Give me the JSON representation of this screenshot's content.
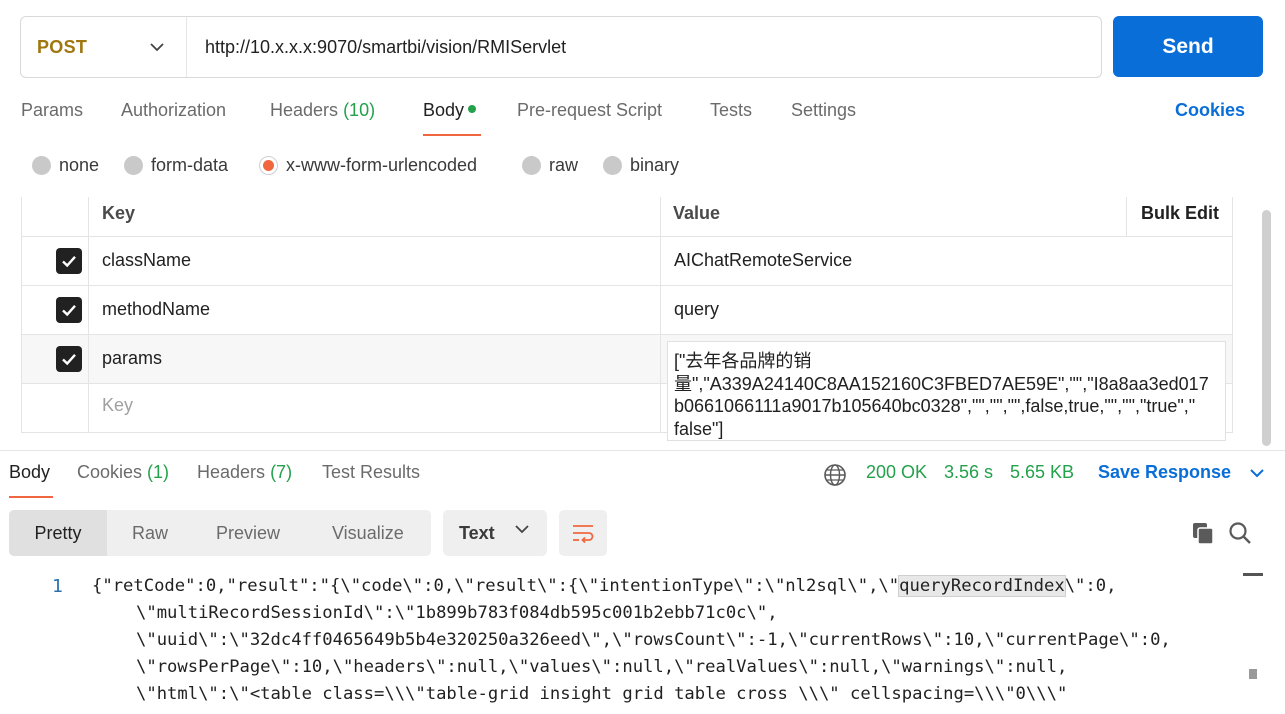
{
  "request": {
    "method": "POST",
    "url": "http://10.x.x.x:9070/smartbi/vision/RMIServlet",
    "send_label": "Send"
  },
  "req_tabs": {
    "params": "Params",
    "authorization": "Authorization",
    "headers_label": "Headers",
    "headers_count": "(10)",
    "body": "Body",
    "prerequest": "Pre-request Script",
    "tests": "Tests",
    "settings": "Settings",
    "cookies": "Cookies"
  },
  "body_types": {
    "none": "none",
    "form_data": "form-data",
    "urlencoded": "x-www-form-urlencoded",
    "raw": "raw",
    "binary": "binary",
    "selected": "x-www-form-urlencoded"
  },
  "table": {
    "key_header": "Key",
    "value_header": "Value",
    "bulk_edit": "Bulk Edit",
    "rows": [
      {
        "key": "className",
        "value": "AIChatRemoteService",
        "checked": true
      },
      {
        "key": "methodName",
        "value": "query",
        "checked": true
      },
      {
        "key": "params",
        "value": "[\"去年各品牌的销量\",\"A339A24140C8AA152160C3FBED7AE59E\",\"\",\"I8a8aa3ed017b0661066111a9017b105640bc0328\",\"\",\"\",\"\",false,true,\"\",\"\",\"true\",\"false\"]",
        "checked": true
      }
    ],
    "new_key_placeholder": "Key",
    "params_display": "[\"去年各品牌的销\n量\",\"A339A24140C8AA152160C3FBED7AE59E\",\"\",\"I8a8aa3ed017\nb0661066111a9017b105640bc0328\",\"\",\"\",\"\",false,true,\"\",\"\",\"true\",\"\nfalse\"]"
  },
  "response": {
    "tabs": {
      "body": "Body",
      "cookies_label": "Cookies",
      "cookies_count": "(1)",
      "headers_label": "Headers",
      "headers_count": "(7)",
      "test_results": "Test Results"
    },
    "status": "200 OK",
    "time": "3.56 s",
    "size": "5.65 KB",
    "save_response": "Save Response",
    "views": {
      "pretty": "Pretty",
      "raw": "Raw",
      "preview": "Preview",
      "visualize": "Visualize"
    },
    "format": "Text",
    "line_number": "1",
    "code_lines": {
      "l1a": "{\"retCode\":0,\"result\":\"{\\\"code\\\":0,\\\"result\\\":{\\\"intentionType\\\":\\\"nl2sql\\\",\\\"",
      "l1hl": "queryRecordIndex",
      "l1b": "\\\":0,",
      "l2": "\\\"multiRecordSessionId\\\":\\\"1b899b783f084db595c001b2ebb71c0c\\\",",
      "l3": "\\\"uuid\\\":\\\"32dc4ff0465649b5b4e320250a326eed\\\",\\\"rowsCount\\\":-1,\\\"currentRows\\\":10,\\\"currentPage\\\":0,",
      "l4": "\\\"rowsPerPage\\\":10,\\\"headers\\\":null,\\\"values\\\":null,\\\"realValues\\\":null,\\\"warnings\\\":null,",
      "l5": "\\\"html\\\":\\\"<table class=\\\\\\\"table-grid insight grid table cross \\\\\\\" cellspacing=\\\\\\\"0\\\\\\\""
    }
  },
  "colors": {
    "accent_blue": "#0a6ed8",
    "active_orange": "#f0673f",
    "success_green": "#23a14b",
    "method_gold": "#a0770f"
  }
}
